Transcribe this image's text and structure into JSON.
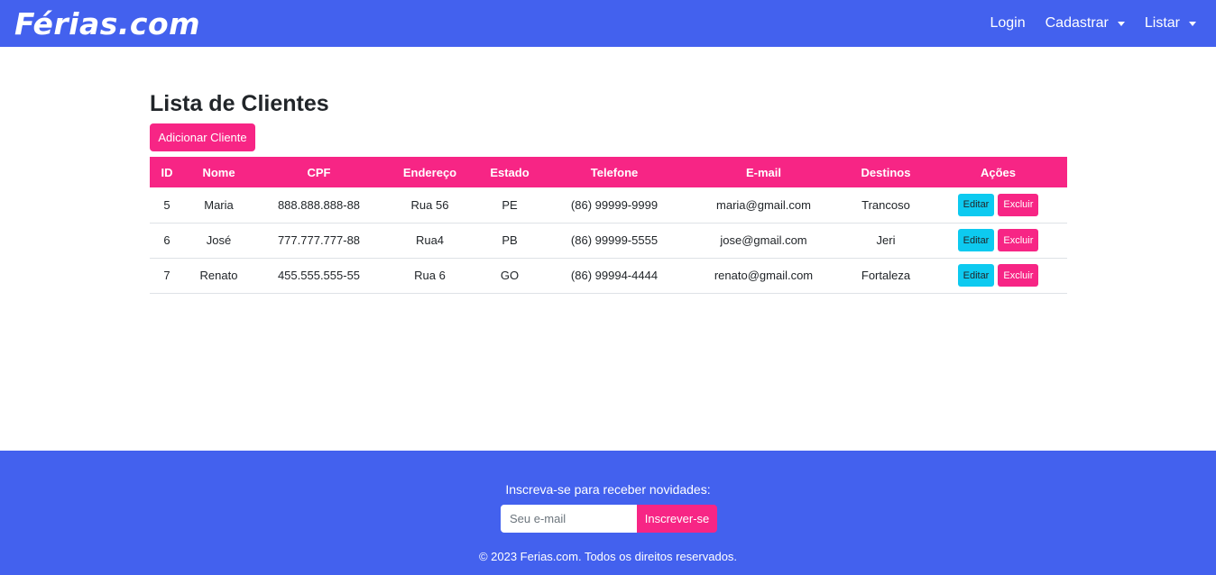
{
  "navbar": {
    "brand": "Férias.com",
    "links": [
      {
        "label": "Login",
        "dropdown": false
      },
      {
        "label": "Cadastrar",
        "dropdown": true
      },
      {
        "label": "Listar",
        "dropdown": true
      }
    ]
  },
  "main": {
    "title": "Lista de Clientes",
    "add_button": "Adicionar Cliente",
    "table": {
      "headers": [
        "ID",
        "Nome",
        "CPF",
        "Endereço",
        "Estado",
        "Telefone",
        "E-mail",
        "Destinos",
        "Ações"
      ],
      "rows": [
        {
          "id": "5",
          "nome": "Maria",
          "cpf": "888.888.888-88",
          "endereco": "Rua 56",
          "estado": "PE",
          "telefone": "(86) 99999-9999",
          "email": "maria@gmail.com",
          "destinos": "Trancoso"
        },
        {
          "id": "6",
          "nome": "José",
          "cpf": "777.777.777-88",
          "endereco": "Rua4",
          "estado": "PB",
          "telefone": "(86) 99999-5555",
          "email": "jose@gmail.com",
          "destinos": "Jeri"
        },
        {
          "id": "7",
          "nome": "Renato",
          "cpf": "455.555.555-55",
          "endereco": "Rua 6",
          "estado": "GO",
          "telefone": "(86) 99994-4444",
          "email": "renato@gmail.com",
          "destinos": "Fortaleza"
        }
      ],
      "edit_label": "Editar",
      "delete_label": "Excluir"
    }
  },
  "footer": {
    "subscribe_text": "Inscreva-se para receber novidades:",
    "email_placeholder": "Seu e-mail",
    "subscribe_button": "Inscrever-se",
    "copyright": "© 2023 Ferias.com. Todos os direitos reservados."
  },
  "colors": {
    "primary": "#4361ee",
    "accent": "#f72585",
    "info": "#0dcaf0"
  }
}
